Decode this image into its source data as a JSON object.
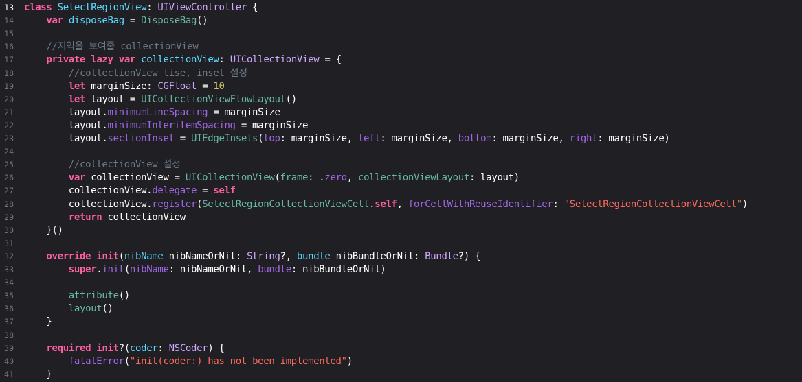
{
  "editor": {
    "current_line": 13,
    "lines": [
      {
        "n": "13",
        "tokens": [
          [
            "kw",
            "class"
          ],
          [
            "pl",
            " "
          ],
          [
            "dc",
            "SelectRegionView"
          ],
          [
            "pl",
            ": "
          ],
          [
            "ty",
            "UIViewController"
          ],
          [
            "pl",
            " {"
          ]
        ]
      },
      {
        "n": "14",
        "tokens": [
          [
            "pl",
            "    "
          ],
          [
            "kw",
            "var"
          ],
          [
            "pl",
            " "
          ],
          [
            "dc",
            "disposeBag"
          ],
          [
            "pl",
            " = "
          ],
          [
            "fn",
            "DisposeBag"
          ],
          [
            "pl",
            "()"
          ]
        ]
      },
      {
        "n": "15",
        "tokens": []
      },
      {
        "n": "16",
        "tokens": [
          [
            "pl",
            "    "
          ],
          [
            "cm",
            "//지역을 보여줄 collectionView"
          ]
        ]
      },
      {
        "n": "17",
        "tokens": [
          [
            "pl",
            "    "
          ],
          [
            "kw",
            "private"
          ],
          [
            "pl",
            " "
          ],
          [
            "kw",
            "lazy"
          ],
          [
            "pl",
            " "
          ],
          [
            "kw",
            "var"
          ],
          [
            "pl",
            " "
          ],
          [
            "dc",
            "collectionView"
          ],
          [
            "pl",
            ": "
          ],
          [
            "ty",
            "UICollectionView"
          ],
          [
            "pl",
            " = {"
          ]
        ]
      },
      {
        "n": "18",
        "tokens": [
          [
            "pl",
            "        "
          ],
          [
            "cm",
            "//collectionView lise, inset 설정"
          ]
        ]
      },
      {
        "n": "19",
        "tokens": [
          [
            "pl",
            "        "
          ],
          [
            "kw",
            "let"
          ],
          [
            "pl",
            " marginSize: "
          ],
          [
            "ty",
            "CGFloat"
          ],
          [
            "pl",
            " = "
          ],
          [
            "nm",
            "10"
          ]
        ]
      },
      {
        "n": "20",
        "tokens": [
          [
            "pl",
            "        "
          ],
          [
            "kw",
            "let"
          ],
          [
            "pl",
            " layout = "
          ],
          [
            "fn",
            "UICollectionViewFlowLayout"
          ],
          [
            "pl",
            "()"
          ]
        ]
      },
      {
        "n": "21",
        "tokens": [
          [
            "pl",
            "        layout."
          ],
          [
            "pr",
            "minimumLineSpacing"
          ],
          [
            "pl",
            " = marginSize"
          ]
        ]
      },
      {
        "n": "22",
        "tokens": [
          [
            "pl",
            "        layout."
          ],
          [
            "pr",
            "minimumInteritemSpacing"
          ],
          [
            "pl",
            " = marginSize"
          ]
        ]
      },
      {
        "n": "23",
        "tokens": [
          [
            "pl",
            "        layout."
          ],
          [
            "pr",
            "sectionInset"
          ],
          [
            "pl",
            " = "
          ],
          [
            "fn",
            "UIEdgeInsets"
          ],
          [
            "pl",
            "("
          ],
          [
            "pr",
            "top"
          ],
          [
            "pl",
            ": marginSize, "
          ],
          [
            "pr",
            "left"
          ],
          [
            "pl",
            ": marginSize, "
          ],
          [
            "pr",
            "bottom"
          ],
          [
            "pl",
            ": marginSize, "
          ],
          [
            "pr",
            "right"
          ],
          [
            "pl",
            ": marginSize)"
          ]
        ]
      },
      {
        "n": "24",
        "tokens": []
      },
      {
        "n": "25",
        "tokens": [
          [
            "pl",
            "        "
          ],
          [
            "cm",
            "//collectionView 설정"
          ]
        ]
      },
      {
        "n": "26",
        "tokens": [
          [
            "pl",
            "        "
          ],
          [
            "kw",
            "var"
          ],
          [
            "pl",
            " collectionView = "
          ],
          [
            "fn",
            "UICollectionView"
          ],
          [
            "pl",
            "("
          ],
          [
            "fn",
            "frame"
          ],
          [
            "pl",
            ": ."
          ],
          [
            "pr",
            "zero"
          ],
          [
            "pl",
            ", "
          ],
          [
            "fn",
            "collectionViewLayout"
          ],
          [
            "pl",
            ": layout)"
          ]
        ]
      },
      {
        "n": "27",
        "tokens": [
          [
            "pl",
            "        collectionView."
          ],
          [
            "pr",
            "delegate"
          ],
          [
            "pl",
            " = "
          ],
          [
            "kw",
            "self"
          ]
        ]
      },
      {
        "n": "28",
        "tokens": [
          [
            "pl",
            "        collectionView."
          ],
          [
            "pr",
            "register"
          ],
          [
            "pl",
            "("
          ],
          [
            "fn",
            "SelectRegionCollectionViewCell"
          ],
          [
            "pl",
            "."
          ],
          [
            "kw",
            "self"
          ],
          [
            "pl",
            ", "
          ],
          [
            "pr",
            "forCellWithReuseIdentifier"
          ],
          [
            "pl",
            ": "
          ],
          [
            "st",
            "\"SelectRegionCollectionViewCell\""
          ],
          [
            "pl",
            ")"
          ]
        ]
      },
      {
        "n": "29",
        "tokens": [
          [
            "pl",
            "        "
          ],
          [
            "kw",
            "return"
          ],
          [
            "pl",
            " collectionView"
          ]
        ]
      },
      {
        "n": "30",
        "tokens": [
          [
            "pl",
            "    }()"
          ]
        ]
      },
      {
        "n": "31",
        "tokens": []
      },
      {
        "n": "32",
        "tokens": [
          [
            "pl",
            "    "
          ],
          [
            "kw",
            "override"
          ],
          [
            "pl",
            " "
          ],
          [
            "kw",
            "init"
          ],
          [
            "pl",
            "("
          ],
          [
            "dc",
            "nibName"
          ],
          [
            "pl",
            " nibNameOrNil: "
          ],
          [
            "ty",
            "String"
          ],
          [
            "pl",
            "?, "
          ],
          [
            "dc",
            "bundle"
          ],
          [
            "pl",
            " nibBundleOrNil: "
          ],
          [
            "ty",
            "Bundle"
          ],
          [
            "pl",
            "?) {"
          ]
        ]
      },
      {
        "n": "33",
        "tokens": [
          [
            "pl",
            "        "
          ],
          [
            "kw",
            "super"
          ],
          [
            "pl",
            "."
          ],
          [
            "pr",
            "init"
          ],
          [
            "pl",
            "("
          ],
          [
            "pr",
            "nibName"
          ],
          [
            "pl",
            ": nibNameOrNil, "
          ],
          [
            "pr",
            "bundle"
          ],
          [
            "pl",
            ": nibBundleOrNil)"
          ]
        ]
      },
      {
        "n": "34",
        "tokens": []
      },
      {
        "n": "35",
        "tokens": [
          [
            "pl",
            "        "
          ],
          [
            "fn",
            "attribute"
          ],
          [
            "pl",
            "()"
          ]
        ]
      },
      {
        "n": "36",
        "tokens": [
          [
            "pl",
            "        "
          ],
          [
            "fn",
            "layout"
          ],
          [
            "pl",
            "()"
          ]
        ]
      },
      {
        "n": "37",
        "tokens": [
          [
            "pl",
            "    }"
          ]
        ]
      },
      {
        "n": "38",
        "tokens": []
      },
      {
        "n": "39",
        "tokens": [
          [
            "pl",
            "    "
          ],
          [
            "kw",
            "required"
          ],
          [
            "pl",
            " "
          ],
          [
            "kw",
            "init"
          ],
          [
            "pl",
            "?("
          ],
          [
            "dc",
            "coder"
          ],
          [
            "pl",
            ": "
          ],
          [
            "ty",
            "NSCoder"
          ],
          [
            "pl",
            ") {"
          ]
        ]
      },
      {
        "n": "40",
        "tokens": [
          [
            "pl",
            "        "
          ],
          [
            "pr",
            "fatalError"
          ],
          [
            "pl",
            "("
          ],
          [
            "st",
            "\"init(coder:) has not been implemented\""
          ],
          [
            "pl",
            ")"
          ]
        ]
      },
      {
        "n": "41",
        "tokens": [
          [
            "pl",
            "    }"
          ]
        ]
      }
    ]
  },
  "colors": {
    "background": "#1f1f24",
    "keyword": "#fc5fa3",
    "type": "#d0a8ff",
    "function": "#67b7a4",
    "declaration": "#5dd8ff",
    "property": "#a167e6",
    "string": "#fc6a5d",
    "number": "#d0bf69",
    "comment": "#6c7986",
    "plain": "#ffffff"
  }
}
